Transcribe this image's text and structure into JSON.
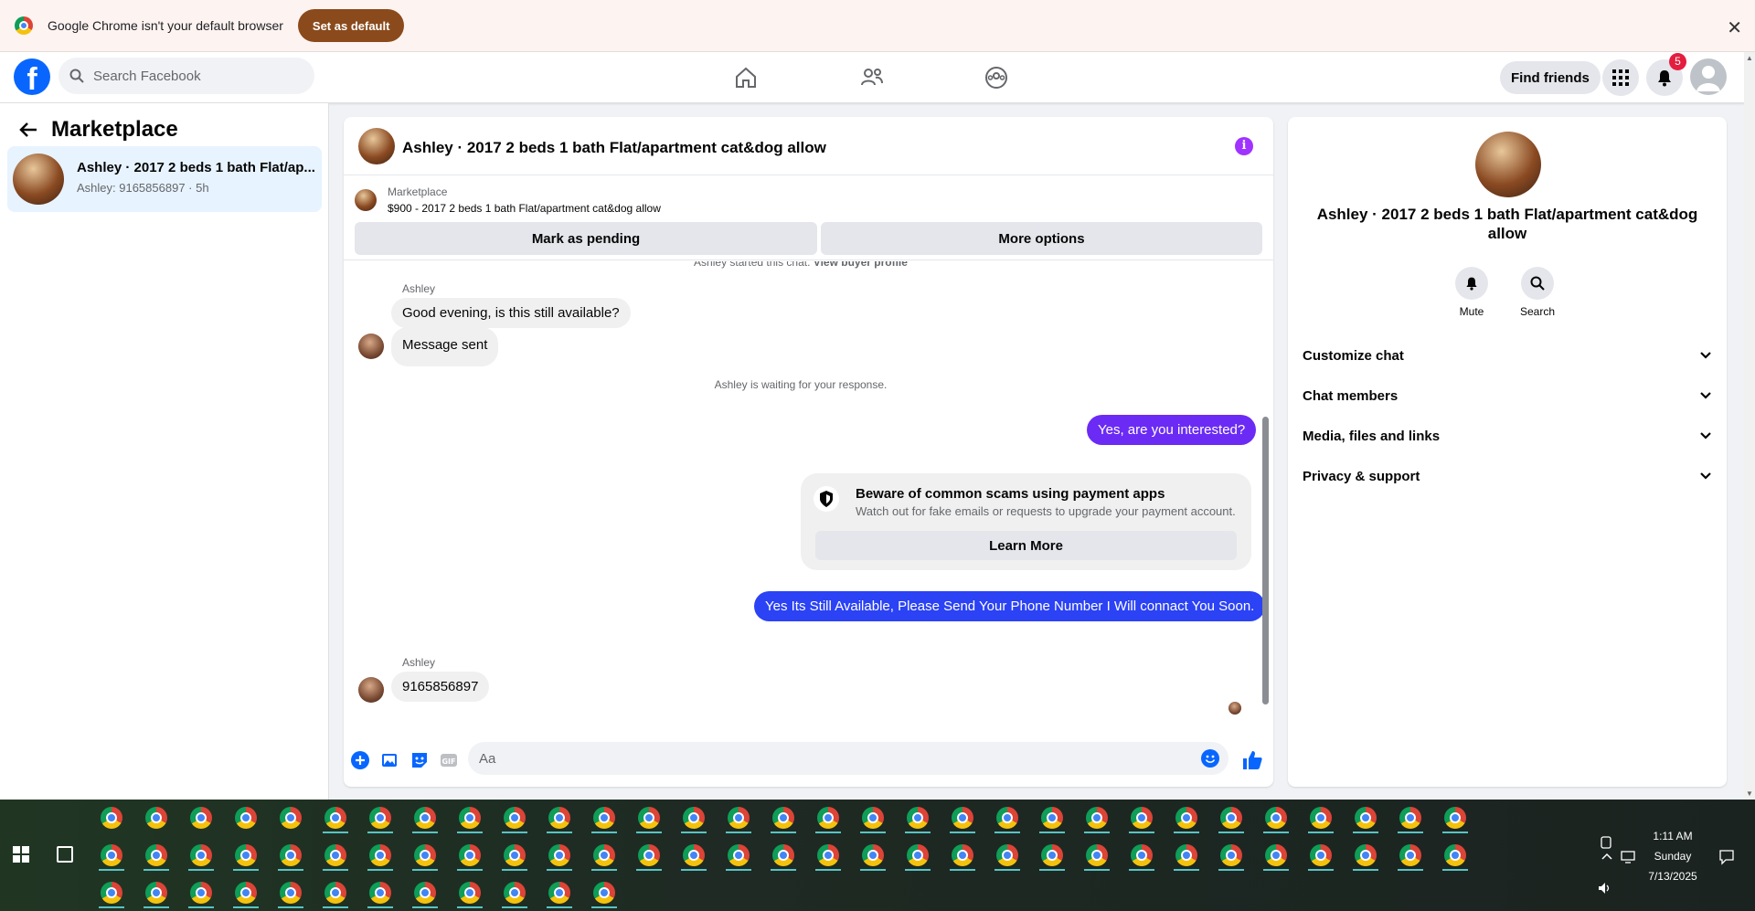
{
  "infobar": {
    "message": "Google Chrome isn't your default browser",
    "set_default": "Set as default"
  },
  "fb": {
    "search_placeholder": "Search Facebook",
    "find_friends": "Find friends",
    "notification_count": "5"
  },
  "left": {
    "title": "Marketplace",
    "conversation": {
      "title": "Ashley · 2017 2 beds 1 bath Flat/ap...",
      "subtitle": "Ashley: 9165856897 · 5h"
    }
  },
  "chat": {
    "header_name": "Ashley · 2017 2 beds 1 bath Flat/apartment cat&dog allow",
    "listing_source": "Marketplace",
    "listing_text": "$900 - 2017 2 beds 1 bath Flat/apartment cat&dog allow",
    "mark_pending": "Mark as pending",
    "more_options": "More options",
    "started_text": "Ashley started this chat.",
    "view_buyer": "View buyer profile",
    "sender1": "Ashley",
    "msg1": "Good evening, is this still available?",
    "msg2": "Message sent",
    "waiting": "Ashley is waiting for your response.",
    "out1": "Yes, are you interested?",
    "scam_title": "Beware of common scams using payment apps",
    "scam_sub": "Watch out for fake emails or requests to upgrade your payment account.",
    "learn_more": "Learn More",
    "out2": "Yes Its Still Available, Please Send Your Phone Number I Will connact You Soon.",
    "sender2": "Ashley",
    "msg3": "9165856897",
    "composer_placeholder": "Aa"
  },
  "info": {
    "name": "Ashley · 2017 2 beds 1 bath Flat/apartment cat&dog allow",
    "mute": "Mute",
    "search": "Search",
    "rows": [
      "Customize chat",
      "Chat members",
      "Media, files and links",
      "Privacy & support"
    ]
  },
  "taskbar": {
    "time": "1:11 AM",
    "day": "Sunday",
    "date": "7/13/2025"
  },
  "colors": {
    "fb_blue": "#0866ff",
    "out_purple": "#6b2bf5",
    "out_blue": "#2b42f5",
    "badge_red": "#e41e3f"
  }
}
